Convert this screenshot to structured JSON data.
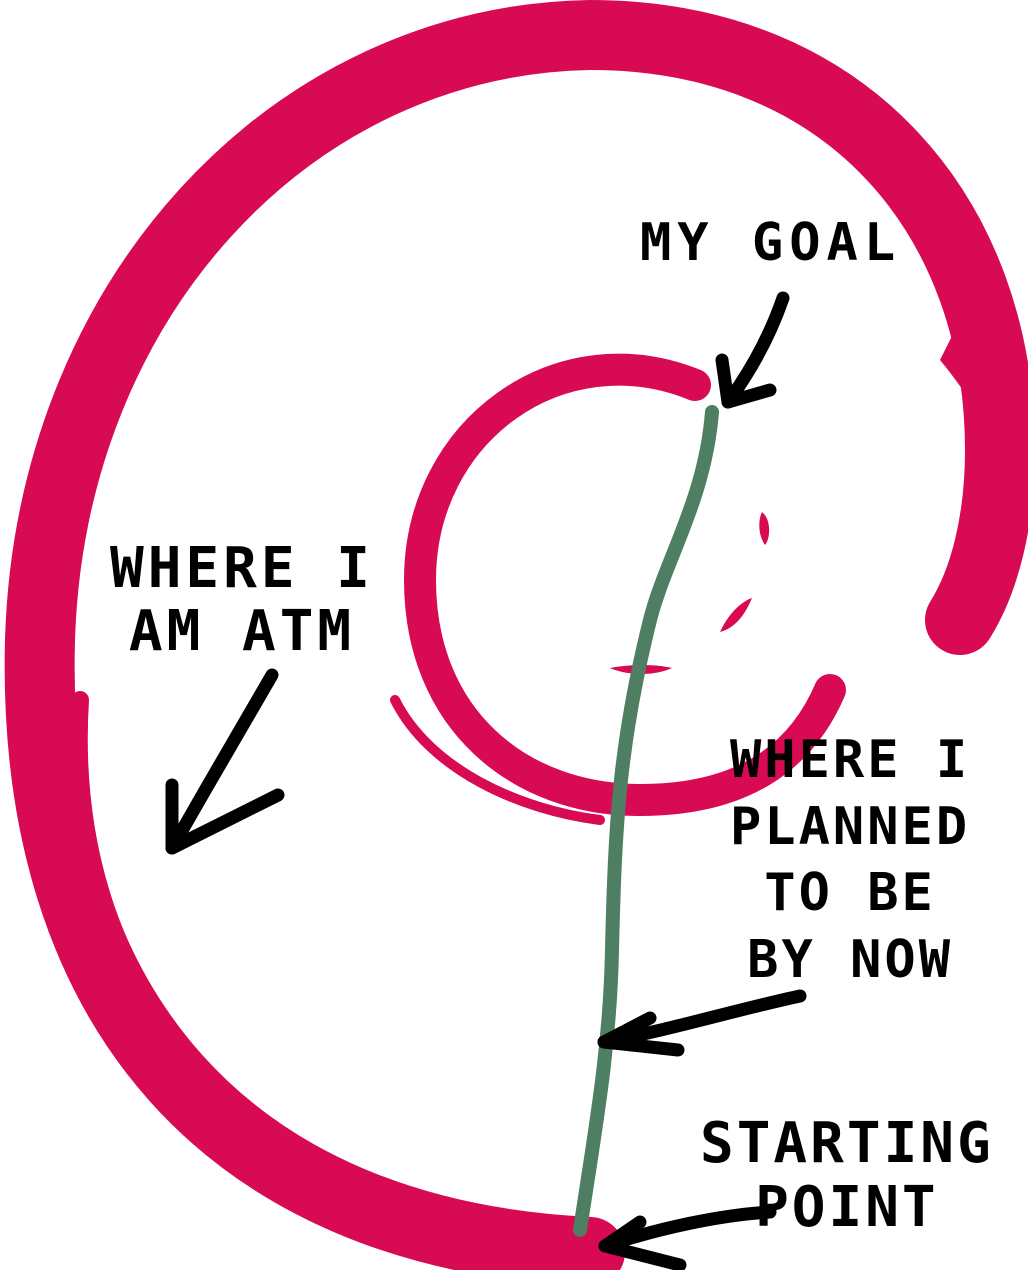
{
  "colors": {
    "swirl": "#D70A53",
    "path": "#4E7F62",
    "ink": "#000000",
    "background": "#FFFFFF"
  },
  "labels": {
    "goal": "MY GOAL",
    "atm": "WHERE I\nAM ATM",
    "planned": "WHERE I\nPLANNED\nTO BE\nBY NOW",
    "start": "STARTING\nPOINT"
  }
}
